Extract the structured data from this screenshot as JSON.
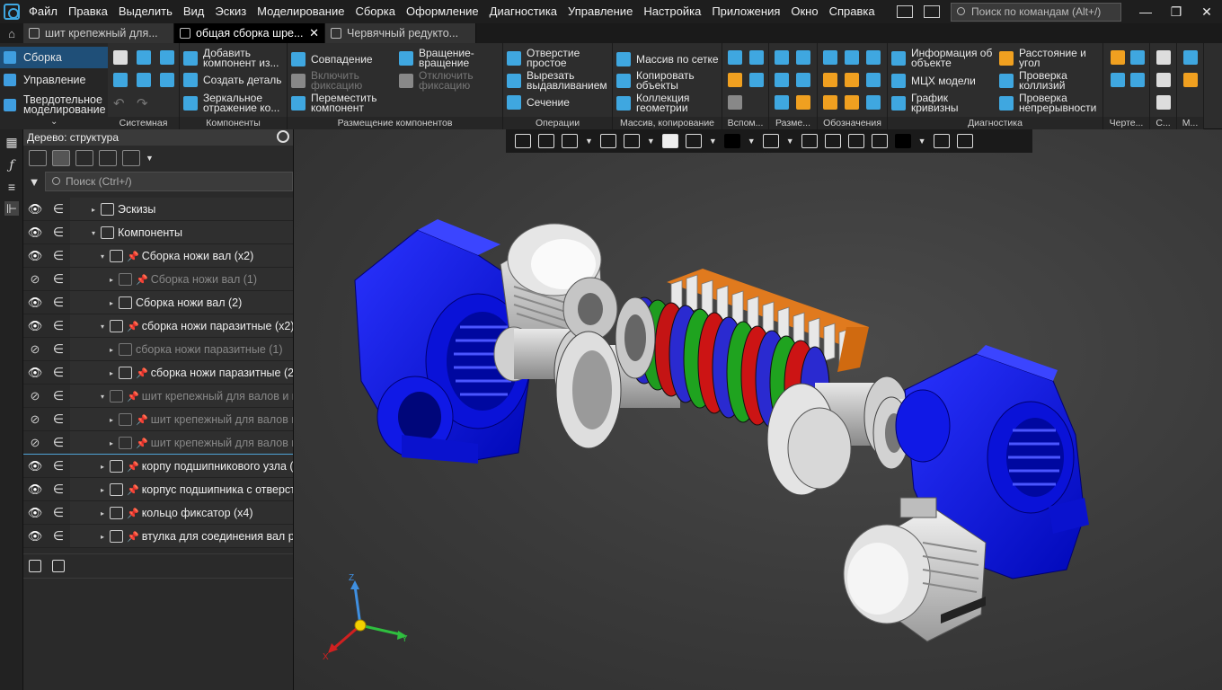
{
  "menubar": {
    "items": [
      "Файл",
      "Правка",
      "Выделить",
      "Вид",
      "Эскиз",
      "Моделирование",
      "Сборка",
      "Оформление",
      "Диагностика",
      "Управление",
      "Настройка",
      "Приложения",
      "Окно",
      "Справка"
    ],
    "search_placeholder": "Поиск по командам (Alt+/)",
    "window_controls": [
      "minimize",
      "restore",
      "close"
    ]
  },
  "tabs": [
    {
      "label": "шит крепежный для...",
      "active": false
    },
    {
      "label": "общая сборка шре...",
      "active": true,
      "close": "✕"
    },
    {
      "label": "Червячный редукто...",
      "active": false
    }
  ],
  "ribbon": {
    "modes": [
      {
        "label": "Сборка",
        "active": true
      },
      {
        "label": "Управление",
        "active": false
      },
      {
        "label": "Твердотельное моделирование",
        "active": false
      }
    ],
    "groups": [
      {
        "label": "Системная"
      },
      {
        "label": "Компоненты",
        "buttons": [
          "Добавить компонент из...",
          "Создать деталь",
          "Зеркальное отражение ко..."
        ]
      },
      {
        "label": "Размещение компонентов",
        "buttons": [
          "Совпадение",
          "Включить фиксацию",
          "Переместить компонент",
          "Вращение-вращение",
          "Отключить фиксацию"
        ]
      },
      {
        "label": "Операции",
        "buttons": [
          "Отверстие простое",
          "Вырезать выдавливанием",
          "Сечение"
        ]
      },
      {
        "label": "Массив, копирование",
        "buttons": [
          "Массив по сетке",
          "Копировать объекты",
          "Коллекция геометрии"
        ]
      },
      {
        "label": "Вспом..."
      },
      {
        "label": "Разме..."
      },
      {
        "label": "Обозначения"
      },
      {
        "label": "Диагностика",
        "buttons": [
          "Информация об объекте",
          "МЦХ модели",
          "График кривизны",
          "Расстояние и угол",
          "Проверка коллизий",
          "Проверка непрерывности"
        ]
      },
      {
        "label": "Черте..."
      },
      {
        "label": "С..."
      },
      {
        "label": "М..."
      }
    ]
  },
  "tree": {
    "title": "Дерево: структура",
    "search_placeholder": "Поиск (Ctrl+/)",
    "rows": [
      {
        "label": "Эскизы",
        "visible": true,
        "level": 0,
        "dim": false
      },
      {
        "label": "Компоненты",
        "visible": true,
        "level": 0,
        "dim": false
      },
      {
        "label": "Сборка ножи вал (x2)",
        "visible": true,
        "level": 1,
        "dim": false
      },
      {
        "label": "Сборка ножи вал (1)",
        "visible": false,
        "level": 2,
        "dim": true
      },
      {
        "label": "Сборка ножи вал (2)",
        "visible": true,
        "level": 2,
        "dim": false
      },
      {
        "label": "сборка ножи паразитные (x2)",
        "visible": true,
        "level": 1,
        "dim": false
      },
      {
        "label": "сборка ножи паразитные (1)",
        "visible": false,
        "level": 2,
        "dim": true
      },
      {
        "label": "сборка ножи паразитные (2)",
        "visible": true,
        "level": 2,
        "dim": false
      },
      {
        "label": "шит крепежный для валов и п",
        "visible": false,
        "level": 1,
        "dim": true
      },
      {
        "label": "шит крепежный для валов и",
        "visible": false,
        "level": 2,
        "dim": true
      },
      {
        "label": "шит крепежный для валов и",
        "visible": false,
        "level": 2,
        "dim": true
      },
      {
        "label": "корпу подшипникового узла (",
        "visible": true,
        "level": 1,
        "dim": false
      },
      {
        "label": "корпус подшипника  с отверст",
        "visible": true,
        "level": 1,
        "dim": false
      },
      {
        "label": "кольцо фиксатор  (x4)",
        "visible": true,
        "level": 1,
        "dim": false
      },
      {
        "label": "втулка для соединения вал ред",
        "visible": true,
        "level": 1,
        "dim": false
      }
    ]
  },
  "viewport": {
    "axes": {
      "z": "Z",
      "y": "Y",
      "x": "X"
    },
    "colors": {
      "housing": "#0a12ee",
      "motor": "#d8d8d8",
      "red": "#cc1414",
      "green": "#1fa31f",
      "orange": "#e07a1e",
      "steel": "#c8c8c8"
    }
  }
}
